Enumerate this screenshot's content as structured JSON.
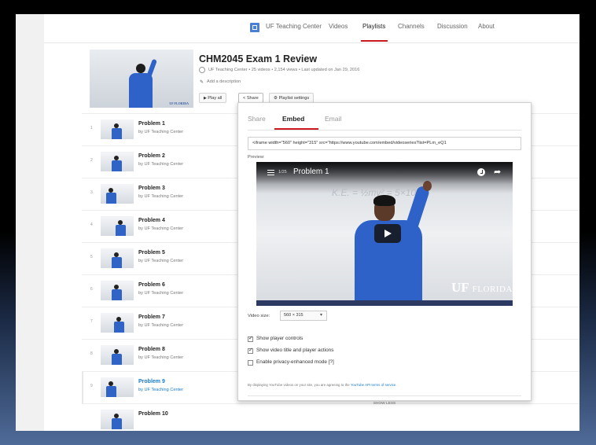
{
  "nav": {
    "channel": "UF Teaching Center",
    "tabs": [
      {
        "label": "Videos"
      },
      {
        "label": "Playlists"
      },
      {
        "label": "Channels"
      },
      {
        "label": "Discussion"
      },
      {
        "label": "About"
      }
    ],
    "active_tab": "Playlists"
  },
  "playlist": {
    "title": "CHM2045 Exam 1 Review",
    "meta": "UF Teaching Center • 25 videos • 2,154 views • Last updated on Jan 29, 2016",
    "add_description": "Add a description",
    "thumb_badge": "UF FLORIDA",
    "buttons": {
      "play_all": "Play all",
      "share": "Share",
      "settings": "Playlist settings"
    }
  },
  "videos": [
    {
      "num": "1",
      "title": "Problem 1",
      "channel": "by UF Teaching Center"
    },
    {
      "num": "2",
      "title": "Problem 2",
      "channel": "by UF Teaching Center"
    },
    {
      "num": "3",
      "title": "Problem 3",
      "channel": "by UF Teaching Center"
    },
    {
      "num": "4",
      "title": "Problem 4",
      "channel": "by UF Teaching Center"
    },
    {
      "num": "5",
      "title": "Problem 5",
      "channel": "by UF Teaching Center"
    },
    {
      "num": "6",
      "title": "Problem 6",
      "channel": "by UF Teaching Center"
    },
    {
      "num": "7",
      "title": "Problem 7",
      "channel": "by UF Teaching Center"
    },
    {
      "num": "8",
      "title": "Problem 8",
      "channel": "by UF Teaching Center"
    },
    {
      "num": "9",
      "title": "Problem 9",
      "channel": "by UF Teaching Center",
      "selected": true
    },
    {
      "num": "",
      "title": "Problem 10",
      "channel": ""
    }
  ],
  "share_popup": {
    "tabs": [
      "Share",
      "Embed",
      "Email"
    ],
    "active_tab": "Embed",
    "embed_code": "<iframe width=\"560\" height=\"315\" src=\"https://www.youtube.com/embed/videoseries?list=PLm_eQ1",
    "preview_label": "Preview:",
    "player": {
      "count": "1/25",
      "title": "Problem 1",
      "board_text": "K.E. = ½mv² = 5×10⁻¹⁹",
      "logo_uf": "UF",
      "logo_florida": "FLORIDA"
    },
    "video_size_label": "Video size:",
    "video_size_value": "560 × 315",
    "options": [
      {
        "label": "Show player controls",
        "checked": true
      },
      {
        "label": "Show video title and player actions",
        "checked": true
      },
      {
        "label": "Enable privacy-enhanced mode [?]",
        "checked": false
      }
    ],
    "terms_prefix": "By displaying YouTube videos on your site, you are agreeing to the ",
    "terms_link": "YouTube API terms of service",
    "terms_suffix": ".",
    "show_less": "SHOW LESS"
  },
  "icons": {
    "channel_logo": "channel-logo-icon",
    "globe": "globe-icon",
    "pencil": "pencil-icon",
    "play": "play-icon",
    "share": "share-icon",
    "settings": "settings-icon",
    "menu": "playlist-menu-icon",
    "clock": "watch-later-icon",
    "share_arrow": "share-arrow-icon",
    "big_play": "play-button-icon"
  },
  "colors": {
    "accent": "#cc181e",
    "link": "#167ac6",
    "shirt": "#2e62c8"
  }
}
